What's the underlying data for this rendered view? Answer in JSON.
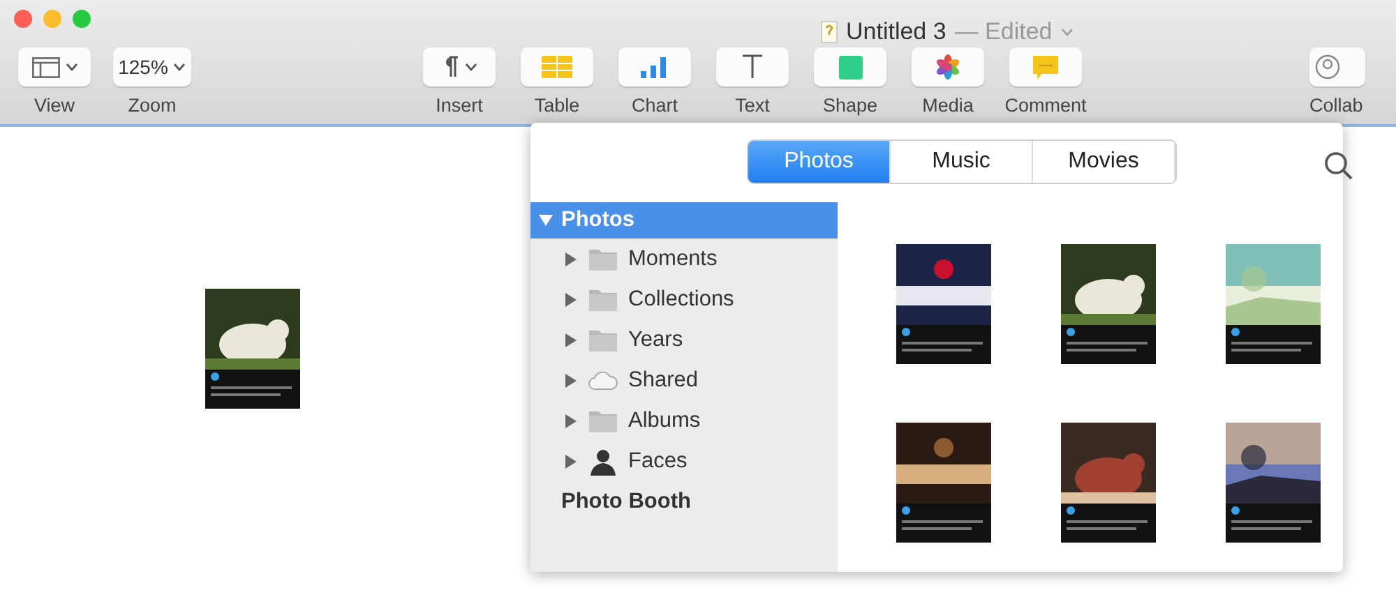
{
  "window": {
    "title": "Untitled 3",
    "status": "— Edited"
  },
  "toolbar": [
    {
      "kind": "view",
      "label": "View",
      "dropdown": true
    },
    {
      "kind": "zoom",
      "label": "Zoom",
      "value": "125%",
      "dropdown": true
    },
    {
      "kind": "insert",
      "label": "Insert",
      "dropdown": true
    },
    {
      "kind": "table",
      "label": "Table",
      "dropdown": false
    },
    {
      "kind": "chart",
      "label": "Chart",
      "dropdown": false
    },
    {
      "kind": "text",
      "label": "Text",
      "dropdown": false
    },
    {
      "kind": "shape",
      "label": "Shape",
      "dropdown": false
    },
    {
      "kind": "media",
      "label": "Media",
      "dropdown": false
    },
    {
      "kind": "comment",
      "label": "Comment",
      "dropdown": false
    },
    {
      "kind": "collaborate",
      "label": "Collab",
      "dropdown": false
    }
  ],
  "media_browser": {
    "tabs": [
      {
        "label": "Photos",
        "selected": true
      },
      {
        "label": "Music",
        "selected": false
      },
      {
        "label": "Movies",
        "selected": false
      }
    ],
    "sidebar": {
      "items": [
        {
          "kind": "section",
          "label": "Photos",
          "selected": true,
          "expanded": true,
          "children": [
            {
              "kind": "folder",
              "label": "Moments",
              "expanded": false
            },
            {
              "kind": "folder",
              "label": "Collections",
              "expanded": false
            },
            {
              "kind": "folder",
              "label": "Years",
              "expanded": false
            },
            {
              "kind": "cloud",
              "label": "Shared",
              "expanded": false
            },
            {
              "kind": "folder",
              "label": "Albums",
              "expanded": false
            },
            {
              "kind": "person",
              "label": "Faces",
              "expanded": false
            }
          ]
        },
        {
          "kind": "item",
          "label": "Photo Booth",
          "selected": false
        }
      ]
    }
  }
}
